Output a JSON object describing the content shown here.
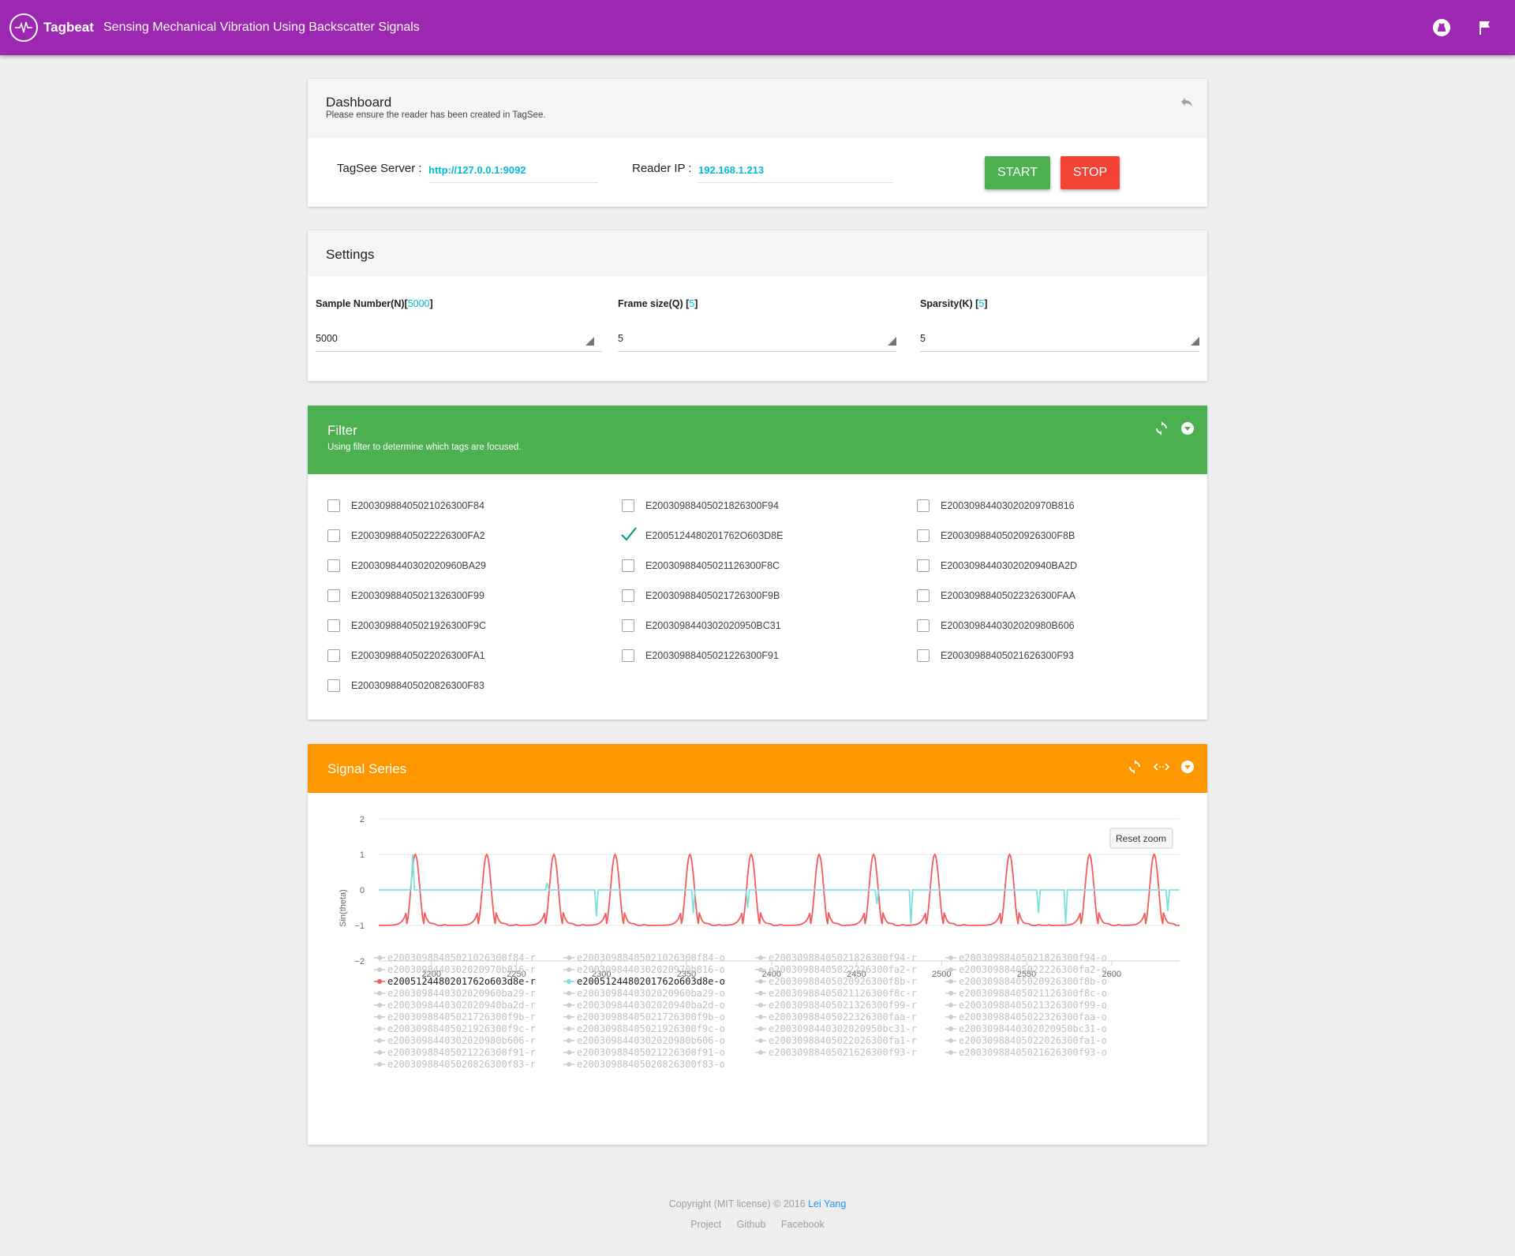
{
  "header": {
    "brand": "Tagbeat",
    "subtitle": "Sensing Mechanical Vibration Using Backscatter Signals",
    "github_icon": "github-icon",
    "flag_icon": "flag-icon",
    "color": "#9c27b0"
  },
  "dashboard": {
    "title": "Dashboard",
    "subtitle": "Please ensure the reader has been created in TagSee.",
    "server_label": "TagSee Server :",
    "server_value": "http://127.0.0.1:9092",
    "reader_label": "Reader IP :",
    "reader_value": "192.168.1.213",
    "start_label": "START",
    "stop_label": "STOP",
    "start_color": "#4caf50",
    "stop_color": "#f44336"
  },
  "settings": {
    "title": "Settings",
    "sample_label": "Sample Number(N)",
    "sample_badge": "5000",
    "sample_value": "5000",
    "frame_label": "Frame size(Q)",
    "frame_badge": "5",
    "frame_value": "5",
    "sparsity_label": "Sparsity(K)",
    "sparsity_badge": "5",
    "sparsity_value": "5"
  },
  "filter": {
    "title": "Filter",
    "subtitle": "Using filter to determine which tags are focused.",
    "color": "#4caf50",
    "tags": [
      {
        "id": "E2003098840502102630 0F84",
        "label": "E200309884050210263O0F84",
        "checked": false
      },
      {
        "label": "E200309884050221826300F94",
        "checked": false
      },
      {
        "label": "E2003098844030202097 0B816",
        "checked": false
      }
    ],
    "columns": [
      [
        {
          "label": "E20030988405021026300F84",
          "checked": false
        },
        {
          "label": "E20030988405022226300FA2",
          "checked": false
        },
        {
          "label": "E2003098440302020960BA29",
          "checked": false
        },
        {
          "label": "E20030988405021326300F99",
          "checked": false
        },
        {
          "label": "E20030988405021926300F9C",
          "checked": false
        },
        {
          "label": "E20030988405022026300FA1",
          "checked": false
        },
        {
          "label": "E20030988405020826300F83",
          "checked": false
        }
      ],
      [
        {
          "label": "E20030988405021826300F94",
          "checked": false
        },
        {
          "label": "E2005124480201762O603D8E",
          "checked": true
        },
        {
          "label": "E20030988405021126300F8C",
          "checked": false
        },
        {
          "label": "E20030988405021726300F9B",
          "checked": false
        },
        {
          "label": "E2003098440302020950BC31",
          "checked": false
        },
        {
          "label": "E20030988405021226300F91",
          "checked": false
        }
      ],
      [
        {
          "label": "E2003098440302020970B816",
          "checked": false
        },
        {
          "label": "E20030988405020926300F8B",
          "checked": false
        },
        {
          "label": "E2003098440302020940BA2D",
          "checked": false
        },
        {
          "label": "E20030988405022326300FAA",
          "checked": false
        },
        {
          "label": "E2003098440302020980B606",
          "checked": false
        },
        {
          "label": "E20030988405021626300F93",
          "checked": false
        }
      ]
    ]
  },
  "signal": {
    "title": "Signal Series",
    "color": "#ff9800",
    "reset_zoom": "Reset zoom",
    "refresh_icon": "refresh-icon",
    "expand_icon": "code-expand-icon",
    "collapse_icon": "chevron-down-circle-icon",
    "legend": [
      {
        "text": "e20030988405021026300f84-r",
        "active": false,
        "color": "#cccccc"
      },
      {
        "text": "e20030988405021026300f84-o",
        "active": false,
        "color": "#cccccc"
      },
      {
        "text": "e20030988405021826300f94-r",
        "active": false,
        "color": "#cccccc"
      },
      {
        "text": "e20030988405021826300f94-o",
        "active": false,
        "color": "#cccccc"
      },
      {
        "text": "e2003098440302020970b816-r",
        "active": false,
        "color": "#cccccc"
      },
      {
        "text": "e2003098440302020970b816-o",
        "active": false,
        "color": "#cccccc"
      },
      {
        "text": "e20030988405022226300fa2-r",
        "active": false,
        "color": "#cccccc"
      },
      {
        "text": "e20030988405022226300fa2-o",
        "active": false,
        "color": "#cccccc"
      },
      {
        "text": "e2005124480201762o603d8e-r",
        "active": true,
        "color": "#f45b5b"
      },
      {
        "text": "e2005124480201762o603d8e-o",
        "active": true,
        "color": "#7cdfe0"
      },
      {
        "text": "e20030988405020926300f8b-r",
        "active": false,
        "color": "#cccccc"
      },
      {
        "text": "e20030988405020926300f8b-o",
        "active": false,
        "color": "#cccccc"
      },
      {
        "text": "e2003098440302020960ba29-r",
        "active": false,
        "color": "#cccccc"
      },
      {
        "text": "e2003098440302020960ba29-o",
        "active": false,
        "color": "#cccccc"
      },
      {
        "text": "e20030988405021126300f8c-r",
        "active": false,
        "color": "#cccccc"
      },
      {
        "text": "e20030988405021126300f8c-o",
        "active": false,
        "color": "#cccccc"
      },
      {
        "text": "e2003098440302020940ba2d-r",
        "active": false,
        "color": "#cccccc"
      },
      {
        "text": "e2003098440302020940ba2d-o",
        "active": false,
        "color": "#cccccc"
      },
      {
        "text": "e20030988405021326300f99-r",
        "active": false,
        "color": "#cccccc"
      },
      {
        "text": "e20030988405021326300f99-o",
        "active": false,
        "color": "#cccccc"
      },
      {
        "text": "e20030988405021726300f9b-r",
        "active": false,
        "color": "#cccccc"
      },
      {
        "text": "e20030988405021726300f9b-o",
        "active": false,
        "color": "#cccccc"
      },
      {
        "text": "e20030988405022326300faa-r",
        "active": false,
        "color": "#cccccc"
      },
      {
        "text": "e20030988405022326300faa-o",
        "active": false,
        "color": "#cccccc"
      },
      {
        "text": "e20030988405021926300f9c-r",
        "active": false,
        "color": "#cccccc"
      },
      {
        "text": "e20030988405021926300f9c-o",
        "active": false,
        "color": "#cccccc"
      },
      {
        "text": "e2003098440302020950bc31-r",
        "active": false,
        "color": "#cccccc"
      },
      {
        "text": "e2003098440302020950bc31-o",
        "active": false,
        "color": "#cccccc"
      },
      {
        "text": "e2003098440302020980b606-r",
        "active": false,
        "color": "#cccccc"
      },
      {
        "text": "e2003098440302020980b606-o",
        "active": false,
        "color": "#cccccc"
      },
      {
        "text": "e20030988405022026300fa1-r",
        "active": false,
        "color": "#cccccc"
      },
      {
        "text": "e20030988405022026300fa1-o",
        "active": false,
        "color": "#cccccc"
      },
      {
        "text": "e20030988405021226300f91-r",
        "active": false,
        "color": "#cccccc"
      },
      {
        "text": "e20030988405021226300f91-o",
        "active": false,
        "color": "#cccccc"
      },
      {
        "text": "e20030988405021626300f93-r",
        "active": false,
        "color": "#cccccc"
      },
      {
        "text": "e20030988405021626300f93-o",
        "active": false,
        "color": "#cccccc"
      },
      {
        "text": "e20030988405020826300f83-r",
        "active": false,
        "color": "#cccccc"
      },
      {
        "text": "e20030988405020826300f83-o",
        "active": false,
        "color": "#cccccc"
      }
    ]
  },
  "chart_data": {
    "type": "line",
    "title": "",
    "xlabel": "",
    "ylabel": "Sin(theta)",
    "xlim": [
      2169,
      2640
    ],
    "ylim": [
      -2,
      2
    ],
    "xticks": [
      2200,
      2250,
      2300,
      2350,
      2400,
      2450,
      2500,
      2550,
      2600
    ],
    "yticks": [
      2,
      1,
      0,
      -1,
      -2
    ],
    "ytick_labels": [
      "2",
      "1",
      "0",
      "−1",
      "−2"
    ],
    "grid": true,
    "peaks": [
      2190.5,
      2232.5,
      2272,
      2308,
      2352,
      2388,
      2428,
      2460,
      2496,
      2540,
      2587,
      2625
    ],
    "series": [
      {
        "name": "e2005124480201762o603d8e-r",
        "color": "#f45b5b",
        "shape": "periodic peaks between -1 and 1"
      },
      {
        "name": "e2005124480201762o603d8e-o",
        "color": "#7cdfe0",
        "baseline": 0,
        "spikes": [
          [
            2189,
            1
          ],
          [
            2268,
            0.2
          ],
          [
            2297,
            -0.75
          ],
          [
            2354,
            -0.65
          ],
          [
            2386,
            -0.5
          ],
          [
            2462,
            -0.4
          ],
          [
            2482,
            -0.95
          ],
          [
            2557,
            -0.65
          ],
          [
            2573,
            -0.95
          ],
          [
            2633,
            -0.6
          ]
        ]
      }
    ]
  },
  "footer": {
    "copyright": "Copyright (MIT license) © 2016 ",
    "author": "Lei Yang",
    "links": [
      "Project",
      "Github",
      "Facebook"
    ]
  }
}
